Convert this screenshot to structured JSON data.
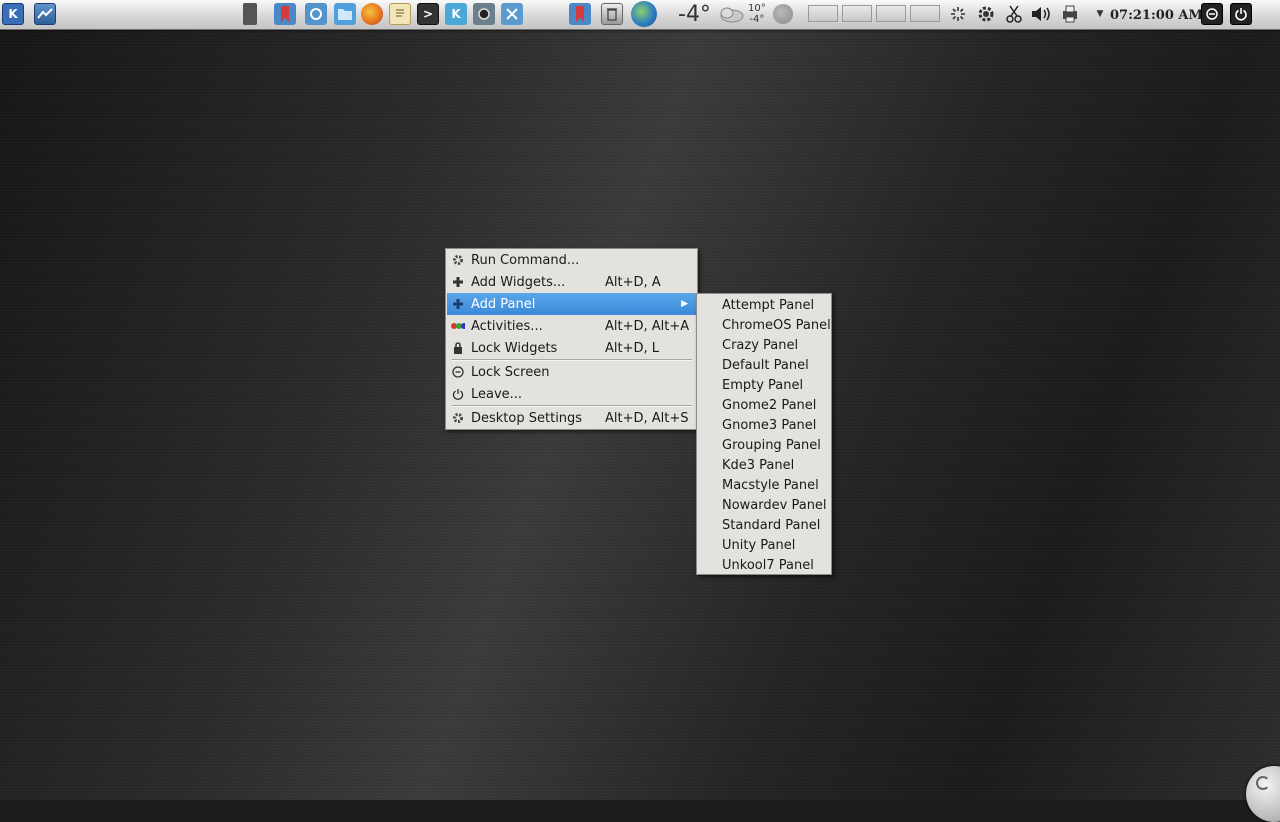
{
  "panel": {
    "launchers": [
      {
        "icon": "kde-launcher-icon",
        "color": "#3a6fb8",
        "text": "K"
      },
      {
        "icon": "show-desktop-icon",
        "color": "#3d6fa3",
        "text": ""
      },
      {
        "icon": "clipboard-icon",
        "color": "#6a6a6a",
        "text": ""
      },
      {
        "icon": "bookmark-icon",
        "color": "#4a88c8",
        "text": ""
      },
      {
        "icon": "system-settings-icon",
        "color": "#5593cc",
        "text": ""
      },
      {
        "icon": "file-manager-icon",
        "color": "#4fa0dc",
        "text": ""
      },
      {
        "icon": "firefox-icon",
        "color": "#e6701f",
        "text": ""
      },
      {
        "icon": "text-editor-icon",
        "color": "#d8c080",
        "text": ""
      },
      {
        "icon": "terminal-icon",
        "color": "#333333",
        "text": ">"
      },
      {
        "icon": "kde-app-icon",
        "color": "#49a8d6",
        "text": "K"
      },
      {
        "icon": "camera-icon",
        "color": "#6a7e8c",
        "text": ""
      },
      {
        "icon": "tools-icon",
        "color": "#5a9ad0",
        "text": ""
      }
    ],
    "tray_left": [
      {
        "icon": "bookmark-tray-icon",
        "color": "#4a88c8"
      },
      {
        "icon": "trash-icon",
        "color": "#7a7a7a"
      },
      {
        "icon": "globe-flag-icon",
        "color": "#2f7fc0"
      }
    ],
    "weather": {
      "current": "-4°",
      "high": "10°",
      "low": "-4°"
    },
    "clock": "07:21:00 AM"
  },
  "menu": {
    "items": [
      {
        "label": "Run Command...",
        "shortcut": "",
        "icon": "gear-icon"
      },
      {
        "label": "Add Widgets...",
        "shortcut": "Alt+D, A",
        "icon": "plus-icon"
      },
      {
        "label": "Add Panel",
        "shortcut": "",
        "icon": "plus-icon"
      },
      {
        "label": "Activities...",
        "shortcut": "Alt+D, Alt+A",
        "icon": "activities-icon"
      },
      {
        "label": "Lock Widgets",
        "shortcut": "Alt+D, L",
        "icon": "lock-icon"
      },
      {
        "label": "Lock Screen",
        "shortcut": "",
        "icon": "lock-screen-icon"
      },
      {
        "label": "Leave...",
        "shortcut": "",
        "icon": "power-icon"
      },
      {
        "label": "Desktop Settings",
        "shortcut": "Alt+D, Alt+S",
        "icon": "gear-icon"
      }
    ],
    "submenu_arrow": "▶"
  },
  "submenu": {
    "items": [
      "Attempt Panel",
      "ChromeOS Panel",
      "Crazy Panel",
      "Default Panel",
      "Empty Panel",
      "Gnome2 Panel",
      "Gnome3 Panel",
      "Grouping Panel",
      "Kde3 Panel",
      "Macstyle Panel",
      "Nowardev Panel",
      "Standard Panel",
      "Unity Panel",
      "Unkool7 Panel"
    ]
  }
}
